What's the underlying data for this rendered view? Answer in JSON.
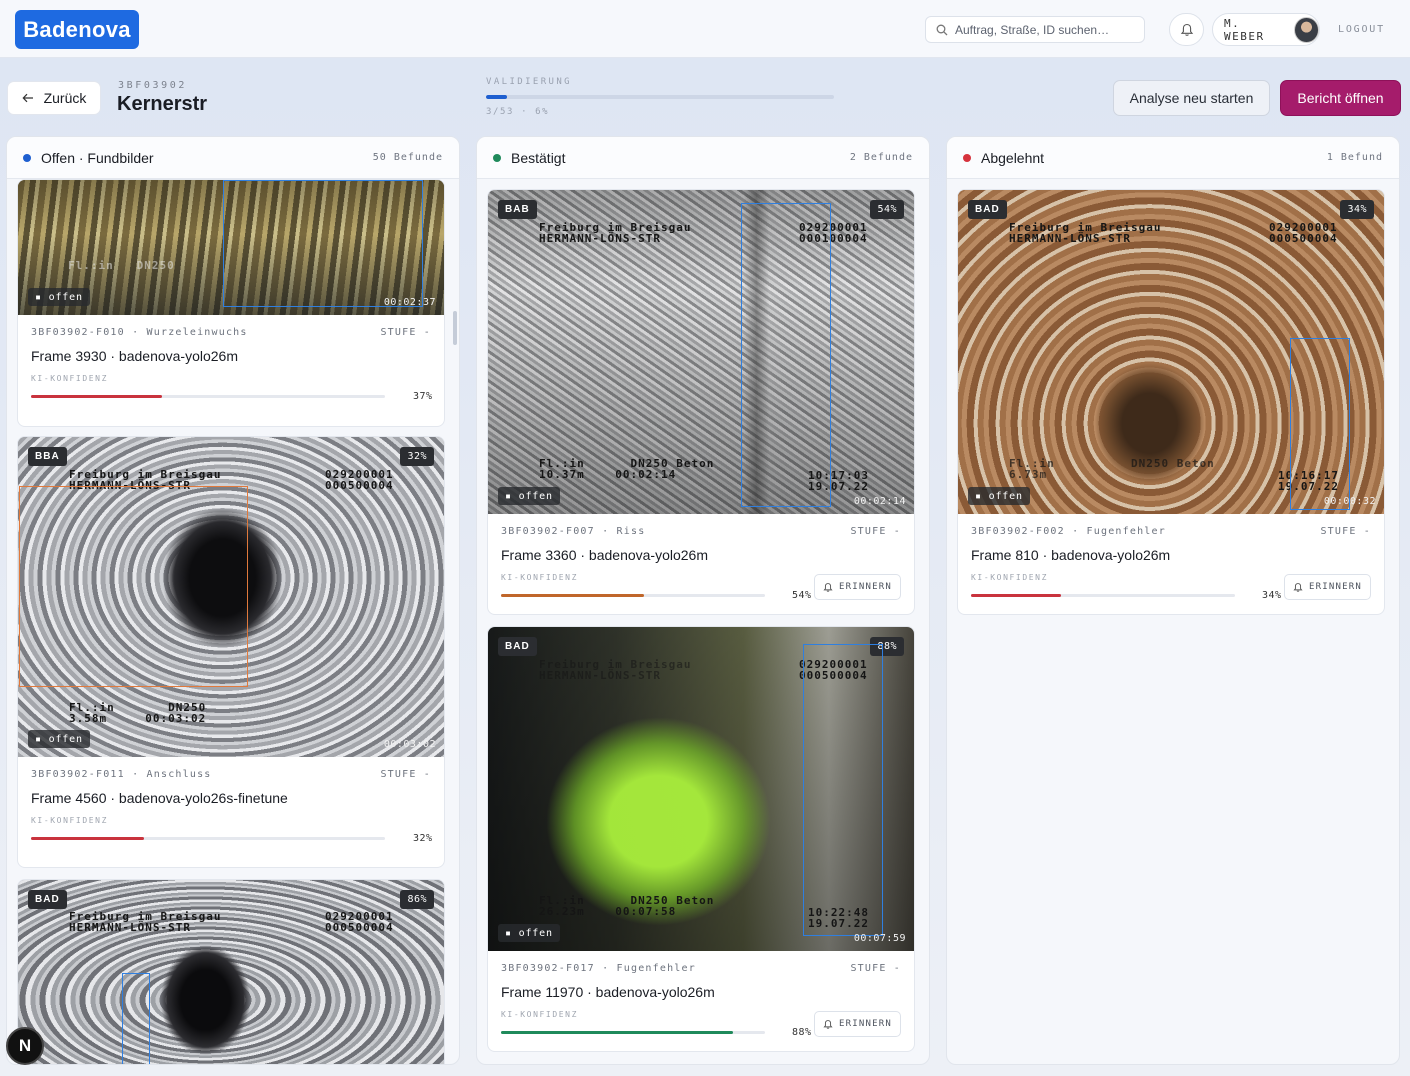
{
  "brand": {
    "logo_text": "Badenova",
    "accent": "#1e6ae1"
  },
  "search": {
    "placeholder": "Auftrag, Straße, ID suchen…",
    "icon": "search-icon"
  },
  "user": {
    "name": "M. WEBER",
    "logout_label": "LOGOUT"
  },
  "header": {
    "back_label": "Zurück",
    "order_id": "3BF03902",
    "street": "Kernerstr",
    "validation_label": "VALIDIERUNG",
    "validation_text": "3/53 · 6%",
    "validation_progress": 0.06,
    "rerun_label": "Analyse neu starten",
    "report_label": "Bericht öffnen",
    "report_color": "#a51c6b"
  },
  "columns": [
    {
      "title": "Offen · Fundbilder",
      "count": "50 Befunde",
      "dot_color": "#1e5fd0",
      "cards": [
        {
          "overlay": "Fl.:in   DN250",
          "offen": "offen",
          "timecode": "00:02:37",
          "meta_id": "3BF03902-F010 · Wurzeleinwuchs",
          "stufe": "STUFE -",
          "frame": "Frame 3930 · badenova-yolo26m",
          "ki": "KI-KONFIDENZ",
          "confidence": "37%",
          "conf_value": 0.37,
          "conf_color": "#c9333d"
        },
        {
          "tag": "BBA",
          "pct": "32%",
          "overlay_top_left": "Freiburg im Breisgau\nHERMANN-LÖNS-STR",
          "overlay_top_right": "029200001\n000500004",
          "overlay_bottom": "Fl.:in       DN250\n3.58m     00:03:02",
          "offen": "offen",
          "timecode": "00:03:02",
          "meta_id": "3BF03902-F011 · Anschluss",
          "stufe": "STUFE -",
          "frame": "Frame 4560 · badenova-yolo26s-finetune",
          "ki": "KI-KONFIDENZ",
          "confidence": "32%",
          "conf_value": 0.32,
          "conf_color": "#c9333d"
        },
        {
          "tag": "BAD",
          "pct": "86%",
          "overlay_top_left": "Freiburg im Breisgau\nHERMANN-LÖNS-STR",
          "overlay_top_right": "029200001\n000500004"
        }
      ]
    },
    {
      "title": "Bestätigt",
      "count": "2 Befunde",
      "dot_color": "#1f8a5b",
      "cards": [
        {
          "tag": "BAB",
          "pct": "54%",
          "overlay_top_left": "Freiburg im Breisgau\nHERMANN-LÖNS-STR",
          "overlay_top_right": "029200001\n000100004",
          "overlay_bottom": "Fl.:in      DN250 Beton\n10.37m    00:02:14",
          "overlay_time": "10:17:03\n19.07.22",
          "offen": "offen",
          "timecode": "00:02:14",
          "meta_id": "3BF03902-F007 · Riss",
          "stufe": "STUFE -",
          "frame": "Frame 3360 · badenova-yolo26m",
          "ki": "KI-KONFIDENZ",
          "confidence": "54%",
          "conf_value": 0.54,
          "conf_color": "#c0662a",
          "remind": "ERINNERN"
        },
        {
          "tag": "BAD",
          "pct": "88%",
          "overlay_top_left": "Freiburg im Breisgau\nHERMANN-LÖNS-STR",
          "overlay_top_right": "029200001\n000500004",
          "overlay_bottom": "Fl.:in      DN250 Beton\n26.23m    00:07:58",
          "overlay_time": "10:22:48\n19.07.22",
          "offen": "offen",
          "timecode": "00:07:59",
          "meta_id": "3BF03902-F017 · Fugenfehler",
          "stufe": "STUFE -",
          "frame": "Frame 11970 · badenova-yolo26m",
          "ki": "KI-KONFIDENZ",
          "confidence": "88%",
          "conf_value": 0.88,
          "conf_color": "#1f8a5b",
          "remind": "ERINNERN"
        }
      ]
    },
    {
      "title": "Abgelehnt",
      "count": "1 Befund",
      "dot_color": "#d6333d",
      "cards": [
        {
          "tag": "BAD",
          "pct": "34%",
          "overlay_top_left": "Freiburg im Breisgau\nHERMANN-LÖNS-STR",
          "overlay_top_right": "029200001\n000500004",
          "overlay_bottom": "Fl.:in          DN250 Beton\n6.73m",
          "overlay_time": "10:16:17\n19.07.22",
          "offen": "offen",
          "timecode": "00:00:32",
          "meta_id": "3BF03902-F002 · Fugenfehler",
          "stufe": "STUFE -",
          "frame": "Frame 810 · badenova-yolo26m",
          "ki": "KI-KONFIDENZ",
          "confidence": "34%",
          "conf_value": 0.34,
          "conf_color": "#c9333d",
          "remind": "ERINNERN"
        }
      ]
    }
  ],
  "corner_badge": "N"
}
